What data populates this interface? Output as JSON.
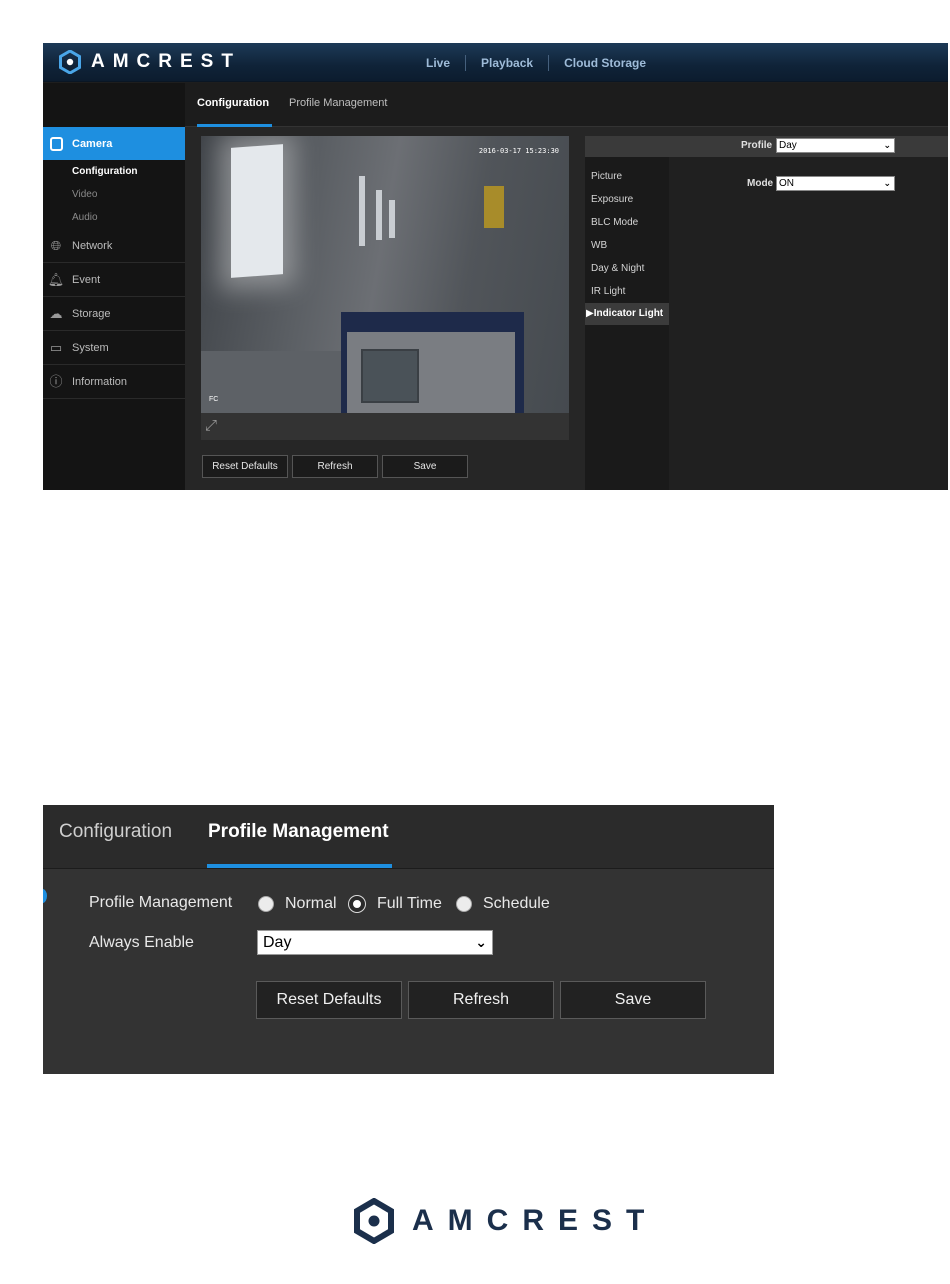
{
  "brand": {
    "name": "AMCREST"
  },
  "shot1": {
    "top_nav": [
      "Live",
      "Playback",
      "Cloud Storage"
    ],
    "sub_tabs": {
      "configuration": "Configuration",
      "profile_management": "Profile Management"
    },
    "sidebar": {
      "camera": "Camera",
      "camera_sub": [
        "Configuration",
        "Video",
        "Audio"
      ],
      "items": [
        {
          "label": "Network",
          "icon": "globe-icon"
        },
        {
          "label": "Event",
          "icon": "alarm-icon"
        },
        {
          "label": "Storage",
          "icon": "cloud-icon"
        },
        {
          "label": "System",
          "icon": "monitor-icon"
        },
        {
          "label": "Information",
          "icon": "info-icon"
        }
      ]
    },
    "video": {
      "timestamp": "2016-03-17 15:23:30",
      "channel": "FC"
    },
    "buttons": {
      "reset": "Reset Defaults",
      "refresh": "Refresh",
      "save": "Save"
    },
    "panel": {
      "profile_label": "Profile",
      "profile_value": "Day",
      "mode_label": "Mode",
      "mode_value": "ON",
      "menu": [
        "Picture",
        "Exposure",
        "BLC Mode",
        "WB",
        "Day & Night",
        "IR Light",
        "▶Indicator Light"
      ]
    }
  },
  "shot2": {
    "tabs": {
      "configuration": "Configuration",
      "profile_management": "Profile Management"
    },
    "profile_label": "Profile Management",
    "radios": [
      "Normal",
      "Full Time",
      "Schedule"
    ],
    "selected_radio": "Full Time",
    "always_label": "Always Enable",
    "always_value": "Day",
    "buttons": {
      "reset": "Reset Defaults",
      "refresh": "Refresh",
      "save": "Save"
    }
  },
  "colors": {
    "accent": "#1e8fe0",
    "topbar": "#0f2338",
    "panel_bg": "#262626",
    "logo": "#1b2f4b"
  }
}
